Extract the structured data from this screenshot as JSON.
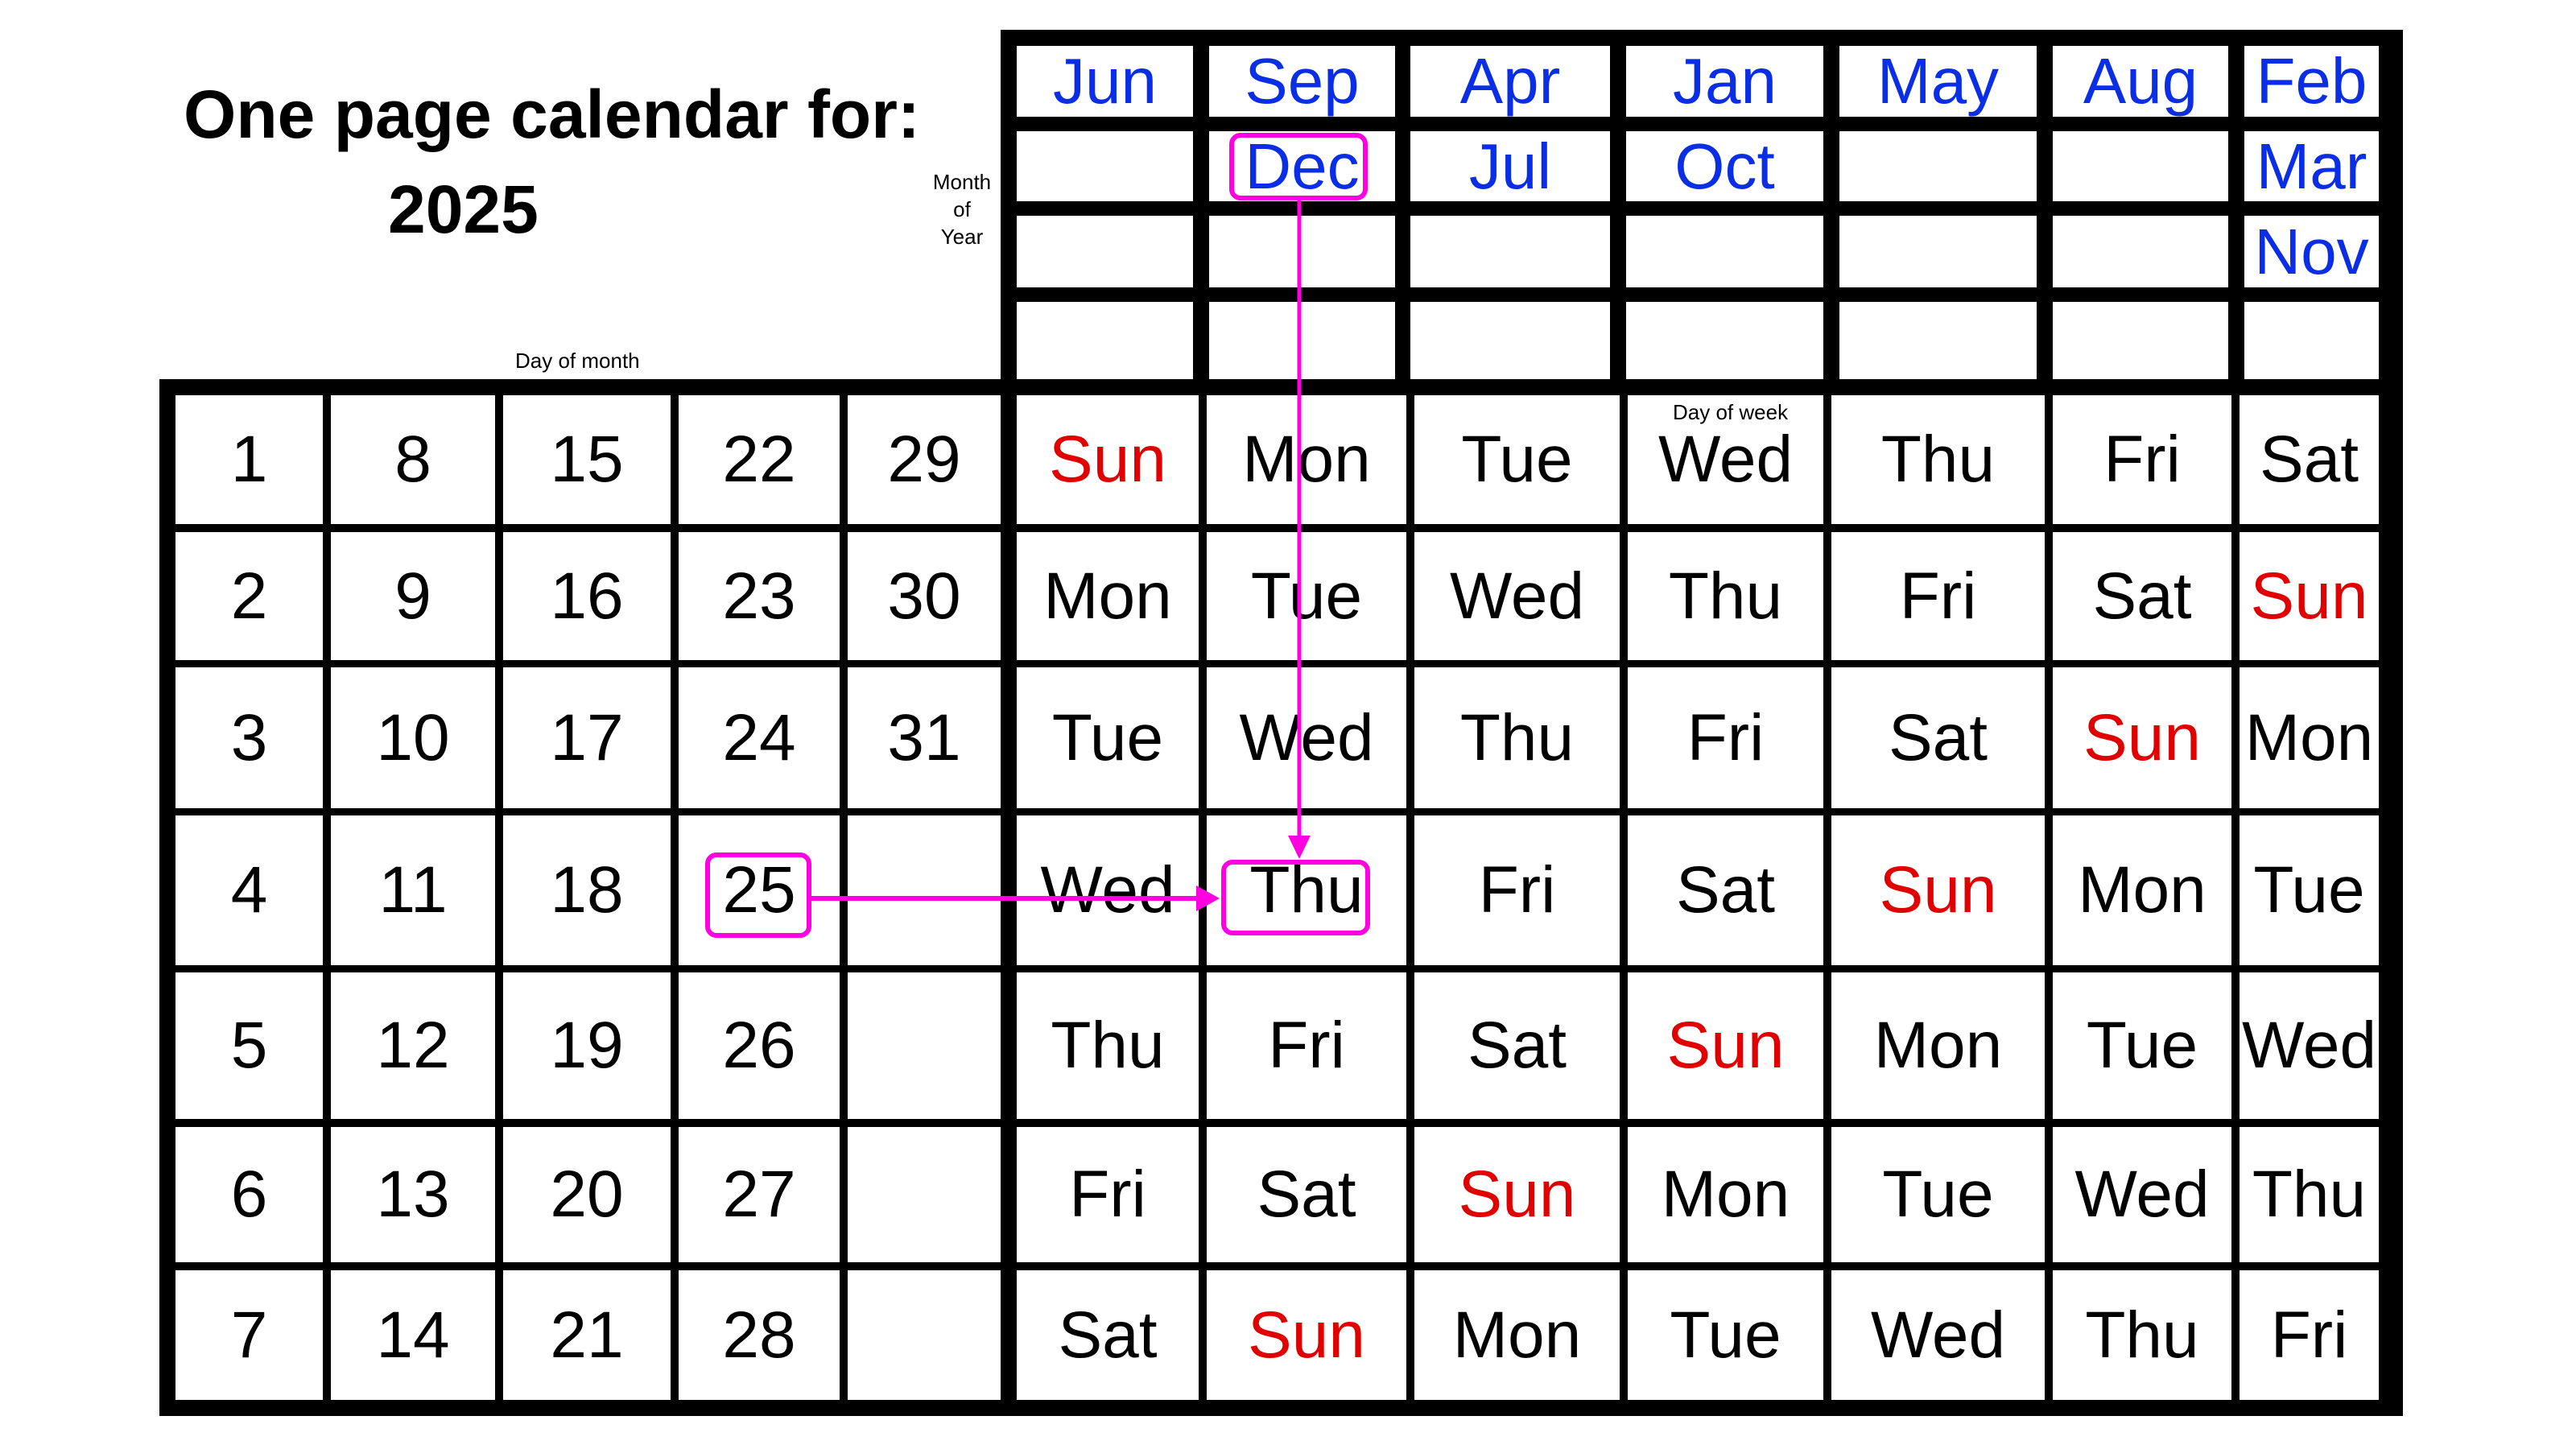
{
  "title": {
    "line1": "One page calendar for:",
    "year": "2025"
  },
  "labels": {
    "day_of_month": "Day of month",
    "month_of_year": [
      "Month",
      "of",
      "Year"
    ],
    "day_of_week": "Day of week"
  },
  "colors": {
    "month_text": "#0a2ee6",
    "sunday_text": "#e00000",
    "highlight": "#ff00e0",
    "grid": "#000000"
  },
  "month_grid": {
    "rows": 4,
    "columns": [
      [
        "Jun",
        "",
        "",
        ""
      ],
      [
        "Sep",
        "Dec",
        "",
        ""
      ],
      [
        "Apr",
        "Jul",
        "",
        ""
      ],
      [
        "Jan",
        "Oct",
        "",
        ""
      ],
      [
        "May",
        "",
        "",
        ""
      ],
      [
        "Aug",
        "",
        "",
        ""
      ],
      [
        "Feb",
        "Mar",
        "Nov",
        ""
      ]
    ]
  },
  "day_of_month_grid": {
    "rows": [
      [
        "1",
        "8",
        "15",
        "22",
        "29"
      ],
      [
        "2",
        "9",
        "16",
        "23",
        "30"
      ],
      [
        "3",
        "10",
        "17",
        "24",
        "31"
      ],
      [
        "4",
        "11",
        "18",
        "25",
        ""
      ],
      [
        "5",
        "12",
        "19",
        "26",
        ""
      ],
      [
        "6",
        "13",
        "20",
        "27",
        ""
      ],
      [
        "7",
        "14",
        "21",
        "28",
        ""
      ]
    ]
  },
  "day_of_week_grid": {
    "rows": [
      [
        "Sun",
        "Mon",
        "Tue",
        "Wed",
        "Thu",
        "Fri",
        "Sat"
      ],
      [
        "Mon",
        "Tue",
        "Wed",
        "Thu",
        "Fri",
        "Sat",
        "Sun"
      ],
      [
        "Tue",
        "Wed",
        "Thu",
        "Fri",
        "Sat",
        "Sun",
        "Mon"
      ],
      [
        "Wed",
        "Thu",
        "Fri",
        "Sat",
        "Sun",
        "Mon",
        "Tue"
      ],
      [
        "Thu",
        "Fri",
        "Sat",
        "Sun",
        "Mon",
        "Tue",
        "Wed"
      ],
      [
        "Fri",
        "Sat",
        "Sun",
        "Mon",
        "Tue",
        "Wed",
        "Thu"
      ],
      [
        "Sat",
        "Sun",
        "Mon",
        "Tue",
        "Wed",
        "Thu",
        "Fri"
      ]
    ]
  },
  "example_lookup": {
    "month": "Dec",
    "day": "25",
    "result": "Thu",
    "month_cell": {
      "column": 1,
      "row": 1
    },
    "day_cell": {
      "row": 3,
      "column": 3
    },
    "result_cell": {
      "row": 3,
      "column": 1
    }
  }
}
